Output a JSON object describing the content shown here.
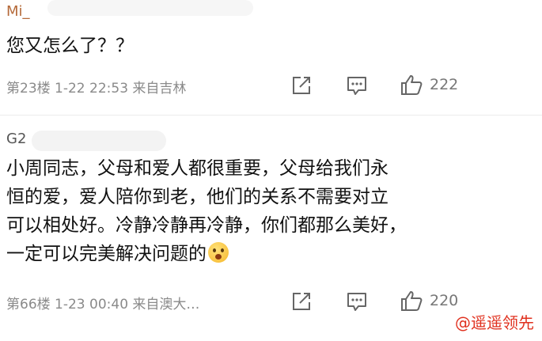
{
  "comments": [
    {
      "username": "Mi_",
      "text": "您又怎么了？？",
      "meta": "第23楼  1-22 22:53  来自吉林",
      "like_count": "222"
    },
    {
      "username": "G2",
      "text_lines": [
        "小周同志，父母和爱人都很重要，父母给我们永",
        "恒的爱，爱人陪你到老，他们的关系不需要对立",
        "可以相处好。冷静冷静再冷静，你们都那么美好，",
        "一定可以完美解决问题的"
      ],
      "meta": "第66楼  1-23 00:40  来自澳大…",
      "like_count": "220"
    }
  ],
  "icons": {
    "share": "share-icon",
    "comment": "comment-icon",
    "like": "thumbs-up-icon",
    "emoji": "worried-face-emoji"
  },
  "watermark": "@遥遥领先",
  "colors": {
    "username1": "#b56a3a",
    "watermark": "#e0301e"
  }
}
